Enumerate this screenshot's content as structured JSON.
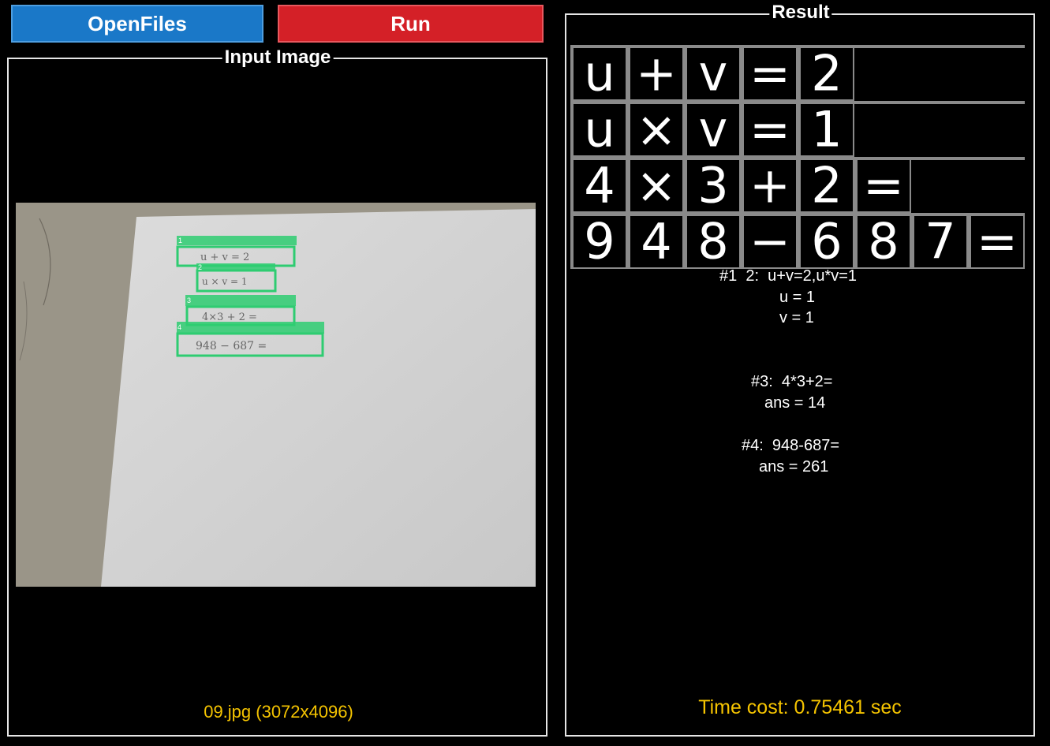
{
  "toolbar": {
    "open_label": "OpenFiles",
    "run_label": "Run"
  },
  "input_panel": {
    "title": "Input Image",
    "file_caption": "09.jpg (3072x4096)",
    "detections": [
      {
        "index": "1",
        "text": "u + v = 2"
      },
      {
        "index": "2",
        "text": "u × v = 1"
      },
      {
        "index": "3",
        "text": "4×3 + 2 ="
      },
      {
        "index": "4",
        "text": "948 − 687 ="
      }
    ]
  },
  "result_panel": {
    "title": "Result",
    "symbol_rows": [
      [
        "u",
        "+",
        "v",
        "=",
        "2"
      ],
      [
        "u",
        "×",
        "v",
        "=",
        "1"
      ],
      [
        "4",
        "×",
        "3",
        "+",
        "2",
        "="
      ],
      [
        "9",
        "4",
        "8",
        "−",
        "6",
        "8",
        "7",
        "="
      ]
    ],
    "results": [
      {
        "line1": "#1  2:  u+v=2,u*v=1",
        "line2": "u = 1",
        "line3": "v = 1"
      },
      {
        "line1": "#3:  4*3+2=",
        "line2": "ans = 14"
      },
      {
        "line1": "#4:  948-687=",
        "line2": "ans = 261"
      }
    ],
    "time_cost": "Time cost: 0.75461 sec"
  },
  "colors": {
    "open_button": "#1a78c8",
    "run_button": "#d42027",
    "caption": "#f5c400",
    "detection_box": "#2ecc71"
  }
}
